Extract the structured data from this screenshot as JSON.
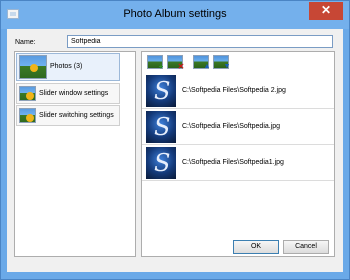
{
  "window": {
    "title": "Photo Album settings",
    "close_glyph": "✕"
  },
  "form": {
    "name_label": "Name:",
    "name_value": "Softpedia"
  },
  "sidebar": {
    "items": [
      {
        "label": "Photos (3)",
        "icon": "landscape-icon",
        "selected": true
      },
      {
        "label": "Slider window settings",
        "icon": "landscape-icon",
        "selected": false
      },
      {
        "label": "Slider switching settings",
        "icon": "landscape-icon",
        "selected": false
      }
    ]
  },
  "toolbar": {
    "buttons": [
      {
        "name": "add-photo",
        "badge": "+"
      },
      {
        "name": "remove-photo",
        "badge": "✕"
      },
      {
        "name": "move-up",
        "badge": "▲"
      },
      {
        "name": "move-down",
        "badge": "▼"
      }
    ]
  },
  "files": [
    {
      "path": "C:\\Softpedia Files\\Softpedia 2.jpg",
      "thumb_letter": "S"
    },
    {
      "path": "C:\\Softpedia Files\\Softpedia.jpg",
      "thumb_letter": "S"
    },
    {
      "path": "C:\\Softpedia Files\\Softpedia1.jpg",
      "thumb_letter": "S"
    }
  ],
  "buttons": {
    "ok": "OK",
    "cancel": "Cancel"
  },
  "colors": {
    "titlebar": "#74b0ec",
    "close": "#c74735",
    "panel_bg": "#f0f0f0"
  }
}
